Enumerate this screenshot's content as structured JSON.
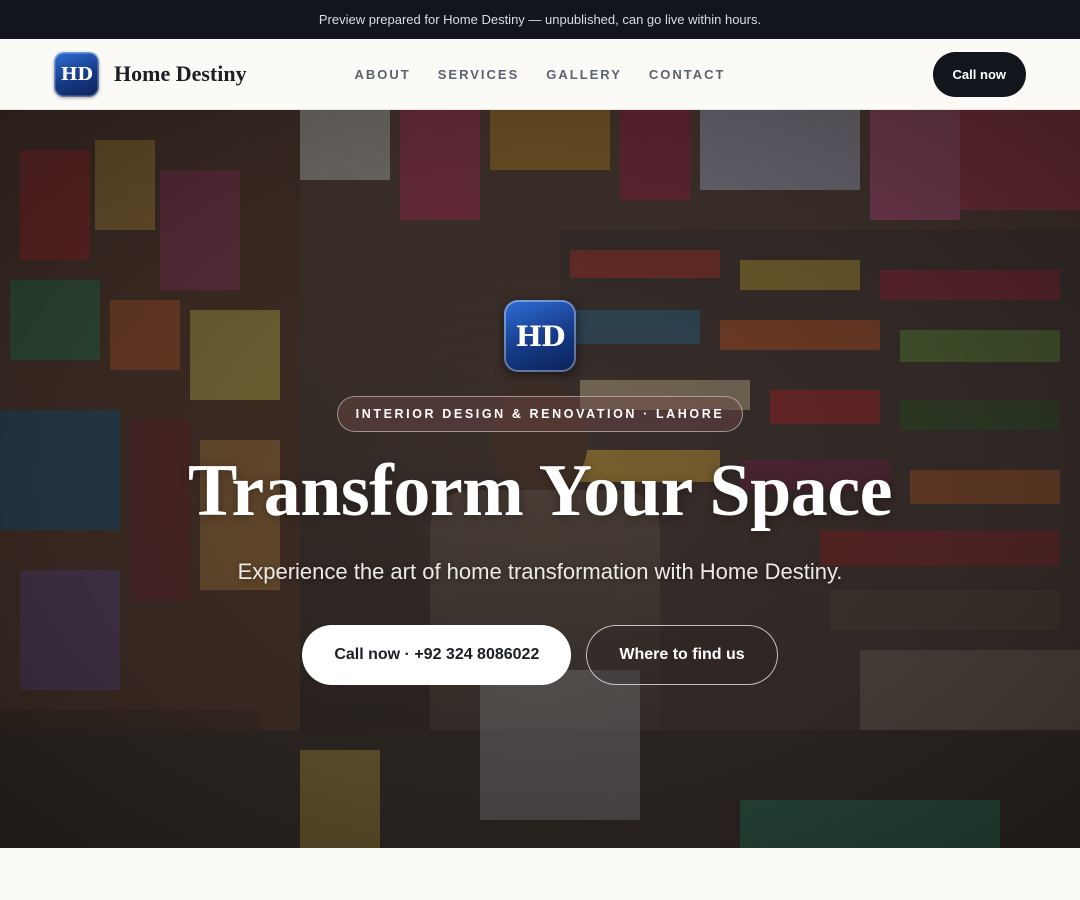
{
  "preview_bar": {
    "text": "Preview prepared for Home Destiny — unpublished, can go live within hours."
  },
  "header": {
    "logo_text": "HD",
    "brand_name": "Home Destiny",
    "nav": [
      {
        "label": "ABOUT"
      },
      {
        "label": "SERVICES"
      },
      {
        "label": "GALLERY"
      },
      {
        "label": "CONTACT"
      }
    ],
    "call_label": "Call now"
  },
  "hero": {
    "logo_text": "HD",
    "tag": "INTERIOR DESIGN & RENOVATION · LAHORE",
    "title": "Transform Your Space",
    "subtitle": "Experience the art of home transformation with Home Destiny.",
    "cta_primary": "Call now · +92 324 8086022",
    "cta_secondary": "Where to find us"
  },
  "colors": {
    "dark": "#12151b",
    "logo_blue": "#153a86",
    "page_bg": "#fbfaf7"
  }
}
